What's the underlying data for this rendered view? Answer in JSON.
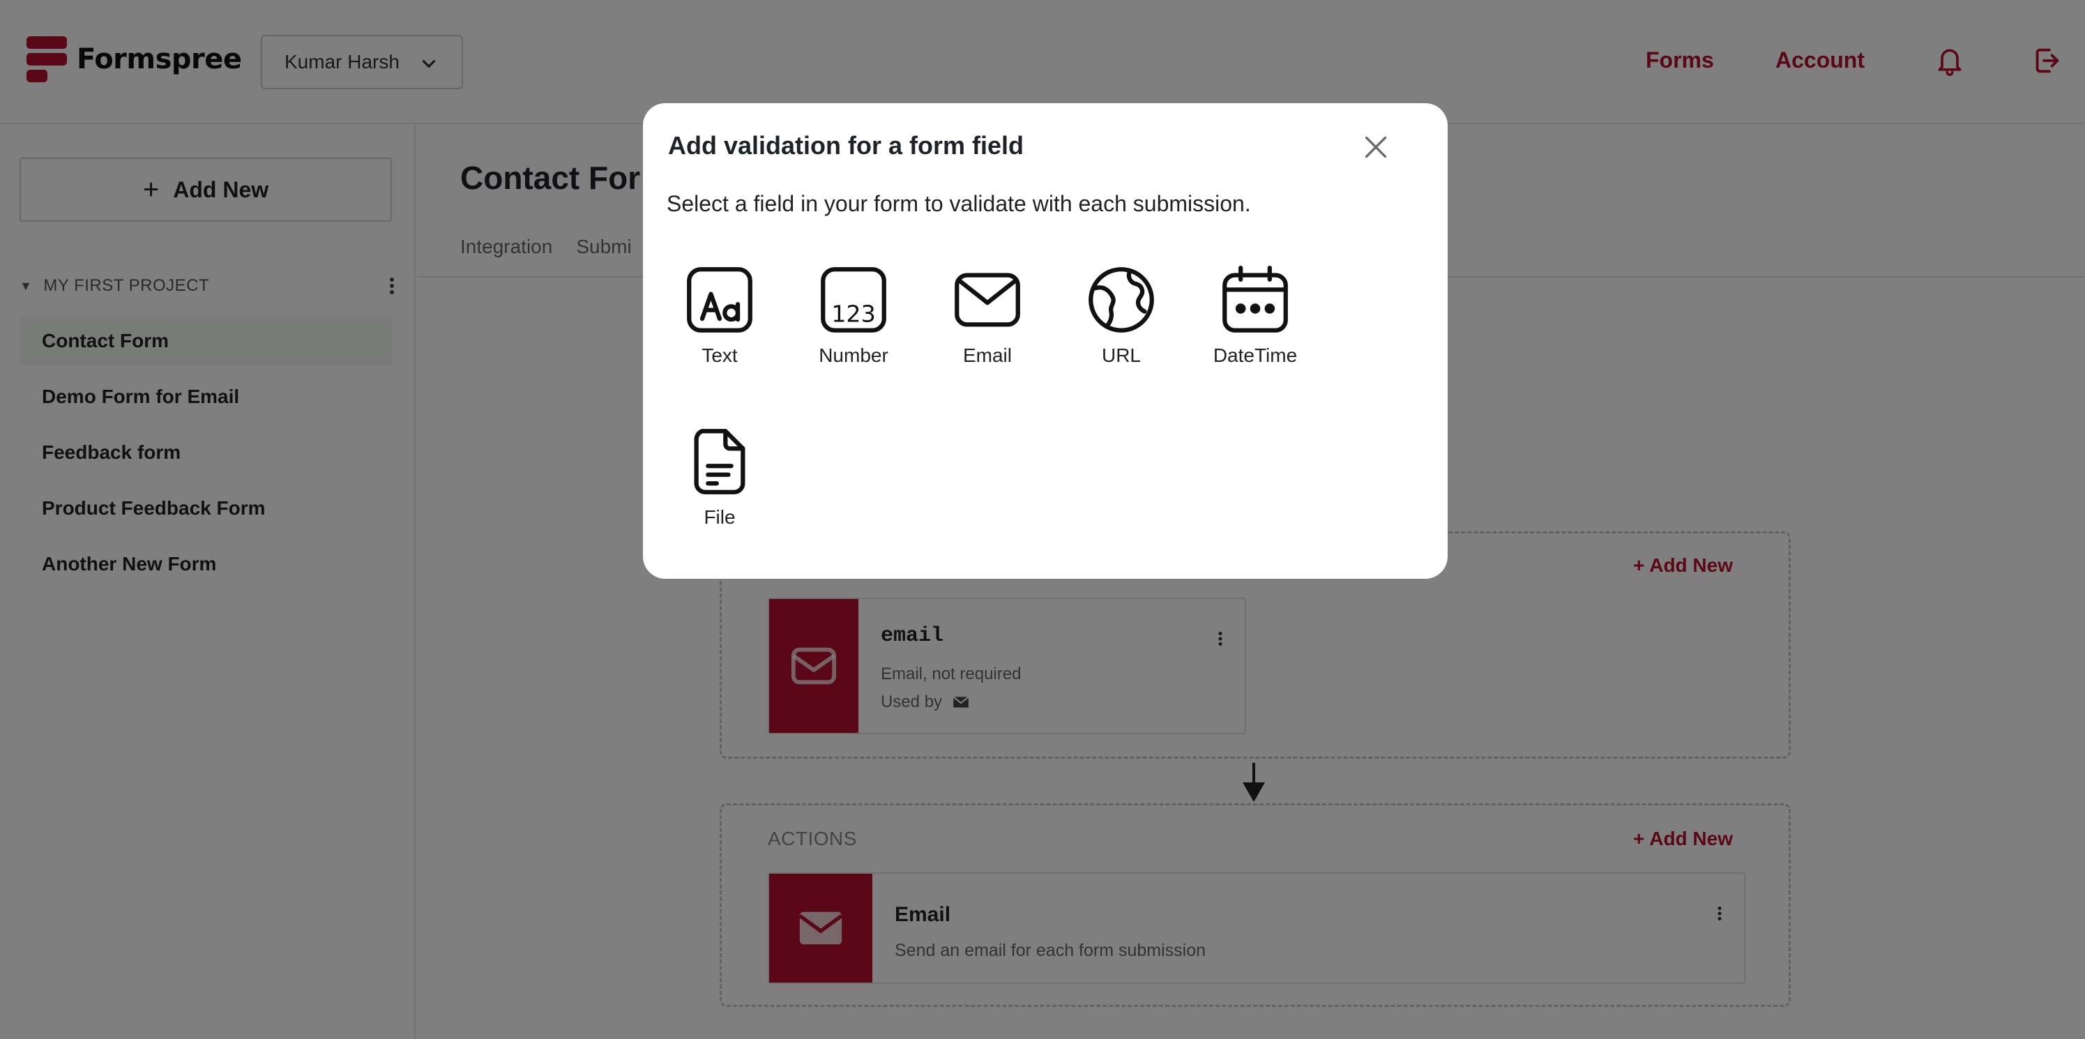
{
  "header": {
    "brand": "Formspree",
    "account": "Kumar Harsh",
    "nav": {
      "forms": "Forms",
      "account": "Account"
    }
  },
  "sidebar": {
    "add_new": "Add New",
    "project": "MY FIRST PROJECT",
    "forms": [
      {
        "label": "Contact Form",
        "active": true
      },
      {
        "label": "Demo Form for Email",
        "active": false
      },
      {
        "label": "Feedback form",
        "active": false
      },
      {
        "label": "Product Feedback Form",
        "active": false
      },
      {
        "label": "Another New Form",
        "active": false
      }
    ]
  },
  "main": {
    "title": "Contact For",
    "tabs": [
      "Integration",
      "Submi"
    ],
    "fields_box": {
      "add_new": "+ Add New",
      "field": {
        "name": "email",
        "description": "Email, not required",
        "used_by": "Used by"
      }
    },
    "actions_box": {
      "label": "ACTIONS",
      "add_new": "+ Add New",
      "action": {
        "title": "Email",
        "description": "Send an email for each form submission"
      }
    }
  },
  "modal": {
    "title": "Add validation for a form field",
    "subtitle": "Select a field in your form to validate with each submission.",
    "field_types": [
      {
        "label": "Text",
        "icon": "text-type-icon"
      },
      {
        "label": "Number",
        "icon": "number-type-icon"
      },
      {
        "label": "Email",
        "icon": "email-type-icon"
      },
      {
        "label": "URL",
        "icon": "globe-icon"
      },
      {
        "label": "DateTime",
        "icon": "calendar-icon"
      },
      {
        "label": "File",
        "icon": "file-icon"
      }
    ]
  },
  "colors": {
    "brand": "#b5112e",
    "overlay": "rgba(0,0,0,0.5)",
    "active_item_bg": "#f1f6f1"
  }
}
